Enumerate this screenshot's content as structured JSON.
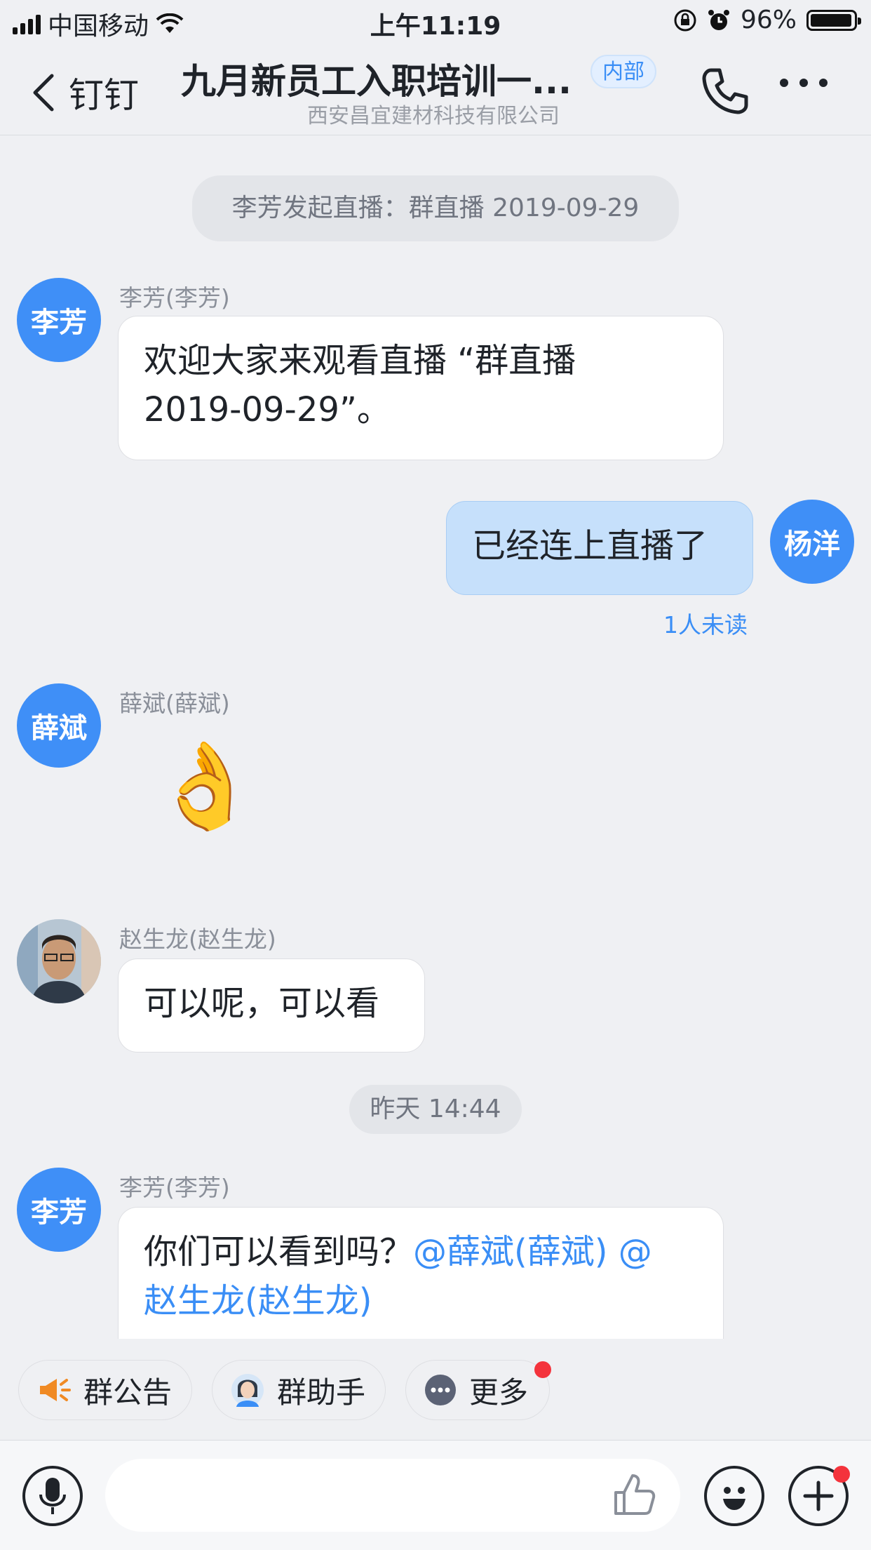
{
  "status_bar": {
    "carrier": "中国移动",
    "time": "上午11:19",
    "battery": "96%"
  },
  "header": {
    "back_label": "钉钉",
    "title": "九月新员工入职培训一...",
    "tag": "内部",
    "subtitle": "西安昌宜建材科技有限公司"
  },
  "messages": {
    "system_live": "李芳发起直播：群直播 2019-09-29",
    "m1": {
      "avatar": "李芳",
      "sender": "李芳(李芳)",
      "line1": "欢迎大家来观看直播 “群直播",
      "line2": "2019-09-29”。"
    },
    "m2": {
      "avatar": "杨洋",
      "text": "已经连上直播了",
      "unread": "1人未读"
    },
    "m3": {
      "avatar": "薛斌",
      "sender": "薛斌(薛斌)",
      "emoji": "👌"
    },
    "m4": {
      "sender": "赵生龙(赵生龙)",
      "text": "可以呢，可以看"
    },
    "time_divider": "昨天 14:44",
    "m5": {
      "avatar": "李芳",
      "sender": "李芳(李芳)",
      "text": "你们可以看到吗？",
      "mention1": "@薛斌(薛斌) @",
      "mention2": "赵生龙(赵生龙)"
    }
  },
  "quick_bar": {
    "announcement": "群公告",
    "assistant": "群助手",
    "more": "更多"
  },
  "colors": {
    "accent": "#3a8ef6",
    "avatar_bg": "#3f8ff7",
    "my_bubble": "#c6e0fb",
    "badge": "#f4333c"
  }
}
